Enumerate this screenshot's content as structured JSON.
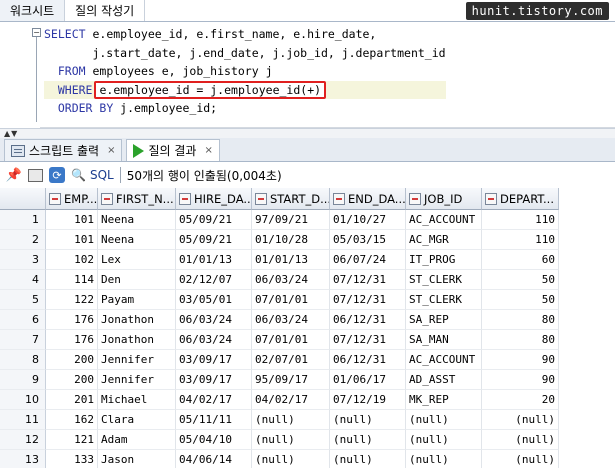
{
  "top_tabs": {
    "worksheet": "워크시트",
    "query_builder": "질의 작성기"
  },
  "watermark": "hunit.tistory.com",
  "editor": {
    "line1": {
      "kw": "SELECT",
      "text": " e.employee_id, e.first_name, e.hire_date,"
    },
    "line2": {
      "text": "       j.start_date, j.end_date, j.job_id, j.department_id"
    },
    "line3": {
      "kw": "FROM",
      "text": " employees e, job_history j"
    },
    "line4": {
      "kw": "WHERE",
      "boxed": "e.employee_id = j.employee_id(+)"
    },
    "line5": {
      "kw": "ORDER BY",
      "text": " j.employee_id;"
    }
  },
  "output_tabs": {
    "script_output": "스크립트 출력",
    "query_result": "질의 결과",
    "close_glyph": "×"
  },
  "toolbar": {
    "sql_label": "SQL",
    "status": "50개의 행이 인출됨(0,004초)"
  },
  "grid": {
    "columns": [
      "EMP...",
      "FIRST_N...",
      "HIRE_DA...",
      "START_D...",
      "END_DA...",
      "JOB_ID",
      "DEPART..."
    ],
    "rows": [
      [
        "1",
        "101",
        "Neena",
        "05/09/21",
        "97/09/21",
        "01/10/27",
        "AC_ACCOUNT",
        "110"
      ],
      [
        "2",
        "101",
        "Neena",
        "05/09/21",
        "01/10/28",
        "05/03/15",
        "AC_MGR",
        "110"
      ],
      [
        "3",
        "102",
        "Lex",
        "01/01/13",
        "01/01/13",
        "06/07/24",
        "IT_PROG",
        "60"
      ],
      [
        "4",
        "114",
        "Den",
        "02/12/07",
        "06/03/24",
        "07/12/31",
        "ST_CLERK",
        "50"
      ],
      [
        "5",
        "122",
        "Payam",
        "03/05/01",
        "07/01/01",
        "07/12/31",
        "ST_CLERK",
        "50"
      ],
      [
        "6",
        "176",
        "Jonathon",
        "06/03/24",
        "06/03/24",
        "06/12/31",
        "SA_REP",
        "80"
      ],
      [
        "7",
        "176",
        "Jonathon",
        "06/03/24",
        "07/01/01",
        "07/12/31",
        "SA_MAN",
        "80"
      ],
      [
        "8",
        "200",
        "Jennifer",
        "03/09/17",
        "02/07/01",
        "06/12/31",
        "AC_ACCOUNT",
        "90"
      ],
      [
        "9",
        "200",
        "Jennifer",
        "03/09/17",
        "95/09/17",
        "01/06/17",
        "AD_ASST",
        "90"
      ],
      [
        "10",
        "201",
        "Michael",
        "04/02/17",
        "04/02/17",
        "07/12/19",
        "MK_REP",
        "20"
      ],
      [
        "11",
        "162",
        "Clara",
        "05/11/11",
        "(null)",
        "(null)",
        "(null)",
        "(null)"
      ],
      [
        "12",
        "121",
        "Adam",
        "05/04/10",
        "(null)",
        "(null)",
        "(null)",
        "(null)"
      ],
      [
        "13",
        "133",
        "Jason",
        "04/06/14",
        "(null)",
        "(null)",
        "(null)",
        "(null)"
      ]
    ]
  }
}
